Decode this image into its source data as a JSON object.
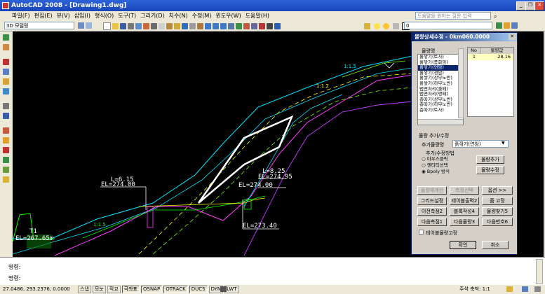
{
  "window": {
    "title": "AutoCAD 2008 - [Drawing1.dwg]"
  },
  "menu": [
    "파일(F)",
    "편집(E)",
    "뷰(V)",
    "삽입(I)",
    "형식(O)",
    "도구(T)",
    "그리기(D)",
    "치수(N)",
    "수정(M)",
    "윈도우(W)",
    "도움말(H)"
  ],
  "help_search_placeholder": "도움말을 원하는 질문 입력",
  "toolbar": {
    "workspace": "3D 모델링",
    "layer": "0"
  },
  "drawing": {
    "labels": {
      "l615": "L=6.15",
      "el274_left": "EL=274.00",
      "l825": "L=8.25",
      "el27495": "EL=274.95",
      "el274_right": "EL=274.00",
      "el27340": "EL=273.40",
      "t1": "T1",
      "el26765": "EL=267.65m",
      "slope_15": "1:1.5",
      "slope_12": "1:1.2",
      "slope_15b": "1:1.5"
    }
  },
  "dialog": {
    "title": "물량상세수정 - 0km060.0000",
    "list_header": "물량명",
    "items": [
      "흙깎기(토사)",
      "흙깎기(풍화암)",
      "흙깎기(연암)",
      "흙깎기(경암)",
      "흙쌓기(상부노반)",
      "흙쌓기(하부노반)",
      "법면처리(줄떼)",
      "법면처리(평떼)",
      "층따기(상부노반)",
      "층따기(하부노반)",
      "층따기(토사)"
    ],
    "selected_index": 2,
    "table_headers": [
      "No",
      "물량값"
    ],
    "table_rows": [
      {
        "no": "1",
        "value": "28.16"
      }
    ],
    "add_group_title": "물량 추가/수정",
    "add_label": "추가물량명",
    "add_value": "흙깎기(연암)",
    "method_title": "추가/수정방법",
    "method_options": [
      "마우스클릭",
      "엔티티선택",
      "Bpoly 방식"
    ],
    "selected_method": 2,
    "btn_add": "물량추가",
    "btn_modify": "물량수정",
    "btn_table_redraw": "물량재계산",
    "btn_measure": "측정선택",
    "btn_options": "옵션 >>",
    "btn_grid": "그리드설정",
    "btn_table_cmd": "테이블출력2",
    "btn_zoom": "줌 고정",
    "btn_prev": "이전측점2",
    "btn_block": "블록작성4",
    "btn_find": "물량찾기5",
    "btn_next_station": "다음측점1",
    "btn_next_qty": "다음물량3",
    "btn_next_no": "다음번호6",
    "checkbox_label": "테이블물량고정",
    "btn_ok": "확인",
    "btn_cancel": "취소"
  },
  "command": {
    "line1": "명령:",
    "line2": "명령:"
  },
  "status": {
    "coords": "27.0486, 293.2376, 0.0000",
    "toggles": [
      "스냅",
      "모눈",
      "직교",
      "극좌표",
      "OSNAP",
      "OTRACK",
      "DUCS",
      "DYN",
      "LWT"
    ],
    "annotation_scale": "주석 축척: 1:1"
  }
}
